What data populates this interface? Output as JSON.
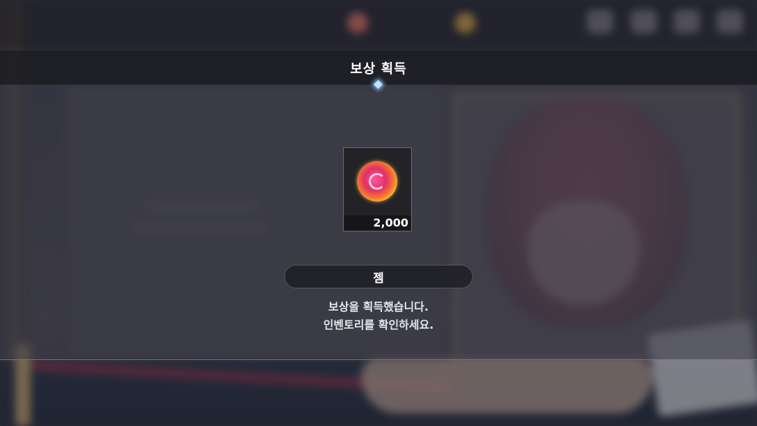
{
  "dialog": {
    "title": "보상 획득",
    "item_name": "젬",
    "item_quantity": "2,000",
    "message_line1": "보상을 획득했습니다.",
    "message_line2": "인벤토리를 확인하세요."
  },
  "icons": {
    "reward": "gem-orb-icon",
    "title_ornament": "diamond-ornament-icon"
  },
  "colors": {
    "title_bar": "#1c1c22",
    "slot_border": "#6b6b72",
    "accent_glow": "#bfe4ff",
    "text": "#ffffff"
  }
}
